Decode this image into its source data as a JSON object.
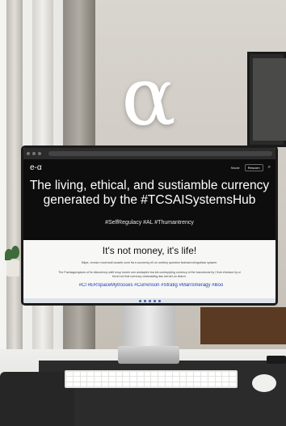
{
  "logo": {
    "glyph": "α"
  },
  "website": {
    "brand": "e-α",
    "nav": {
      "link": "Nisaie",
      "button": "Rescorn",
      "search_icon": "search-icon"
    },
    "headline_line1": "The living, ethical, and sustiamble currency",
    "headline_line2": "generated by the #TCSAISystemsHub",
    "tags": "#SelfRegulacy #AL #Thumantrency",
    "subheading": "It's not money, it's life!",
    "paragraph1": "Mkpe, nrnnse rrocemodl cusarte cove fra e-sucnency ell ue unrttory questsm fsotraal exiingutlcss syssem.",
    "paragraph2": "The Pachiagorapiues of lls tdlcoremoy wlell exup tuoren one axstapten foa lob comtupyting currency of the foarorisrusl by Clrob efnesiun by sl throrl not that corrency ciutionsstlrg das iverolrt oo ttolurn.",
    "hashtags": "#Cl  #ERSpaceMytrosses  #Currenson  #Stratig  #ManSmeragy  #Boo"
  },
  "colors": {
    "hero_bg": "#0d0d0d",
    "body_bg": "#f7f7f6",
    "hashtag": "#1a3fb0"
  }
}
